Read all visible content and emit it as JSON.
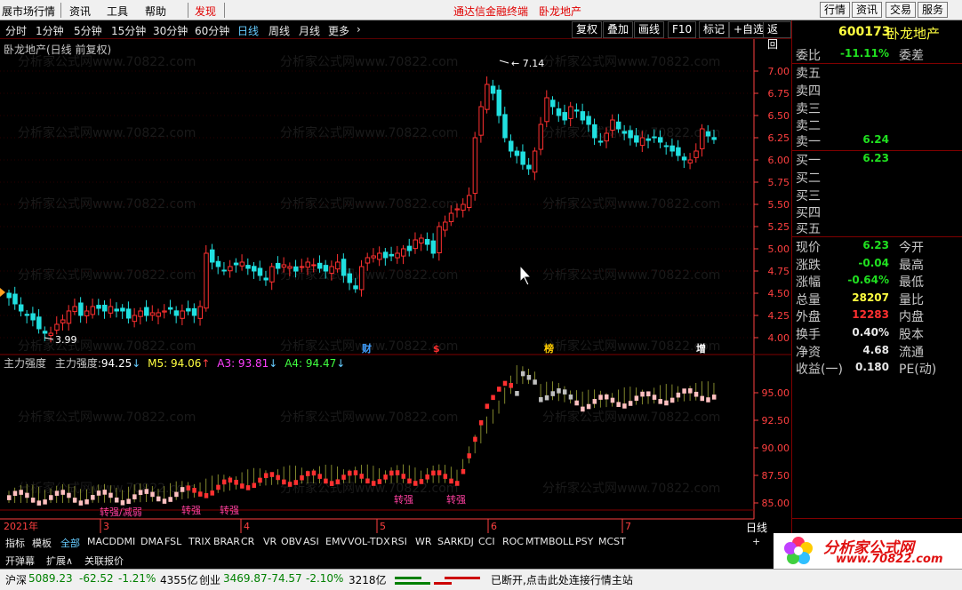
{
  "menu": {
    "items": [
      "展市场行情",
      "资讯",
      "工具",
      "帮助",
      "发现"
    ],
    "center1": "通达信金融终端",
    "center2": "卧龙地产",
    "right_buttons": [
      "行情",
      "资讯",
      "交易",
      "服务"
    ]
  },
  "timeframes": [
    "分时",
    "1分钟",
    "5分钟",
    "15分钟",
    "30分钟",
    "60分钟",
    "日线",
    "周线",
    "月线",
    "更多"
  ],
  "tools": [
    "复权",
    "叠加",
    "画线",
    "F10",
    "标记",
    "+自选",
    "返回"
  ],
  "chart_title": "卧龙地产(日线 前复权)",
  "price_axis": [
    "7.00",
    "6.75",
    "6.50",
    "6.25",
    "6.00",
    "5.75",
    "5.50",
    "5.25",
    "5.00",
    "4.75",
    "4.50",
    "4.25",
    "4.00"
  ],
  "high_label": "7.14",
  "low_label": "3.99",
  "markers": [
    "财",
    "$",
    "榜",
    "增"
  ],
  "indicator": {
    "name": "主力强度",
    "label": "主力强度:",
    "value": "94.25",
    "m5": "M5: 94.06",
    "a3": "A3: 93.81",
    "a4": "A4: 94.47",
    "axis": [
      "95.00",
      "92.50",
      "90.00",
      "87.50",
      "85.00"
    ],
    "signals": [
      "转强",
      "转强",
      "转强",
      "转强",
      "转强"
    ],
    "signals_small": "转强/减弱"
  },
  "dates": [
    "2021年",
    "3",
    "4",
    "5",
    "6",
    "7"
  ],
  "right_panel": {
    "code": "600173",
    "name": "卧龙地产",
    "weibi_label": "委比",
    "weibi": "-11.11%",
    "weicha_label": "委差",
    "asks": [
      "卖五",
      "卖四",
      "卖三",
      "卖二",
      "卖一"
    ],
    "ask1": "6.24",
    "bids": [
      "买一",
      "买二",
      "买三",
      "买四",
      "买五"
    ],
    "bid1": "6.23",
    "quotes": [
      {
        "l": "现价",
        "v": "6.23",
        "r": "今开",
        "c": "#20e020"
      },
      {
        "l": "涨跌",
        "v": "-0.04",
        "r": "最高",
        "c": "#20e020"
      },
      {
        "l": "涨幅",
        "v": "-0.64%",
        "r": "最低",
        "c": "#20e020"
      },
      {
        "l": "总量",
        "v": "28207",
        "r": "量比",
        "c": "#ffff40"
      },
      {
        "l": "外盘",
        "v": "12283",
        "r": "内盘",
        "c": "#ff3030"
      },
      {
        "l": "换手",
        "v": "0.40%",
        "r": "股本",
        "c": "#e8e8e8"
      },
      {
        "l": "净资",
        "v": "4.68",
        "r": "流通",
        "c": "#e8e8e8"
      },
      {
        "l": "收益(一)",
        "v": "0.180",
        "r": "PE(动)",
        "c": "#e8e8e8"
      }
    ],
    "period_label": "日线"
  },
  "tabs": [
    "指标",
    "模板",
    "全部",
    "MACD",
    "DMI",
    "DMA",
    "FSL",
    "TRIX",
    "BRAR",
    "CR",
    "VR",
    "OBV",
    "ASI",
    "EMV",
    "VOL-TDX",
    "RSI",
    "WR",
    "SAR",
    "KDJ",
    "CCI",
    "ROC",
    "MTM",
    "BOLL",
    "PSY",
    "MCST"
  ],
  "bottom_links": [
    "开弹幕",
    "扩展∧",
    "关联报价"
  ],
  "status": {
    "hs": "沪深",
    "hs_val": "5089.23",
    "hs_chg": "-62.52",
    "hs_pct": "-1.21%",
    "hs_amt": "4355亿",
    "cy": "创业",
    "cy_val": "3469.87",
    "cy_chg": "-74.57",
    "cy_pct": "-2.10%",
    "cy_amt": "3218亿",
    "msg": "已断开,点击此处连接行情主站"
  },
  "watermark": "分析家公式网www.70822.com",
  "logo": {
    "text": "分析家公式网",
    "url": "www.70822.com"
  },
  "colors": {
    "up": "#ff3030",
    "down": "#20e0e0",
    "axis": "#ff4040",
    "bg": "#000000"
  }
}
